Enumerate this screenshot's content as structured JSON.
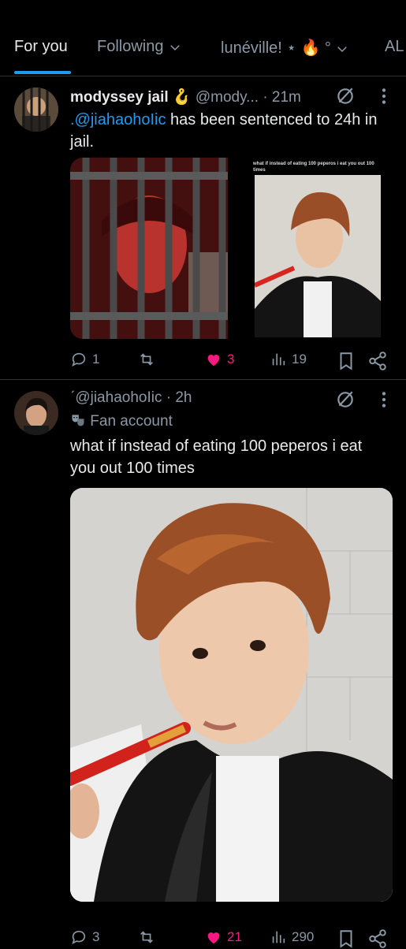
{
  "tabs": [
    {
      "label": "For you"
    },
    {
      "label": "Following"
    },
    {
      "label": "lunéville! ⋆ 🔥 °"
    },
    {
      "label": "AL"
    }
  ],
  "tweet1": {
    "display_name": "modyssey jail 🪝",
    "handle": "@mody...",
    "time": "· 21m",
    "text_mention": ".@jiahaohoIic",
    "text_rest": " has been sentenced to 24h in jail.",
    "quoted_caption": "what if instead of eating 100 peperos i eat you out 100 times",
    "actions": {
      "replies": "1",
      "retweets": "",
      "likes": "3",
      "views": "19"
    }
  },
  "tweet2": {
    "handle": "ˊ@jiahaohoIic",
    "time": "· 2h",
    "label": "Fan account",
    "text": "what if instead of eating 100 peperos i eat you out 100 times",
    "actions": {
      "replies": "3",
      "retweets": "",
      "likes": "21",
      "views": "290"
    }
  },
  "colors": {
    "accent": "#1d9bf0",
    "like": "#f91880",
    "muted": "#8b98a5",
    "bg": "#000000"
  }
}
